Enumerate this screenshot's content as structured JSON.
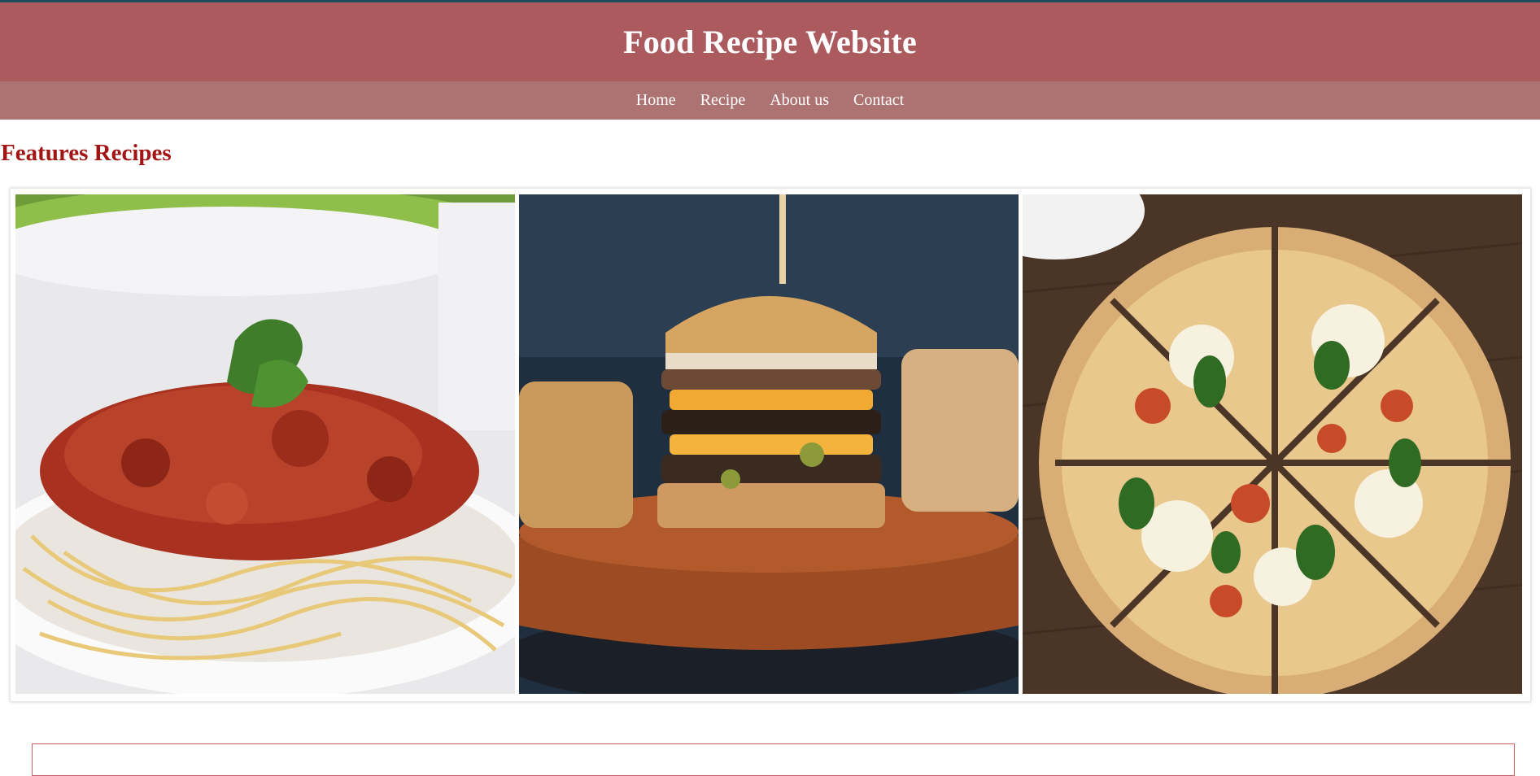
{
  "header": {
    "title": "Food Recipe Website"
  },
  "nav": {
    "items": [
      {
        "label": "Home"
      },
      {
        "label": "Recipe"
      },
      {
        "label": "About us"
      },
      {
        "label": "Contact"
      }
    ]
  },
  "main": {
    "section_title": "Features Recipes",
    "gallery": [
      {
        "image": "spaghetti-bolognese-photo"
      },
      {
        "image": "burger-stack-photo"
      },
      {
        "image": "pizza-photo"
      }
    ]
  },
  "colors": {
    "header_bg": "#ab5b5e",
    "nav_bg": "#ad7373",
    "section_title": "#a31515",
    "top_rule": "#1f4e5a"
  }
}
